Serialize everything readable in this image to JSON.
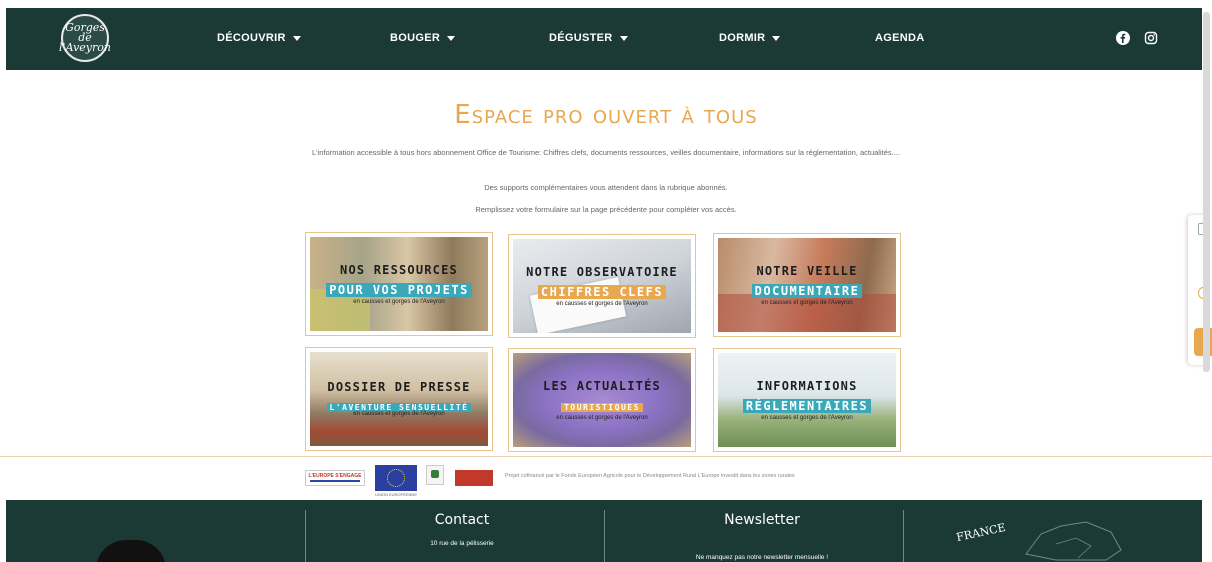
{
  "header": {
    "logo_text": "Gorges de l'Aveyron",
    "nav": [
      {
        "label": "DÉCOUVRIR",
        "dropdown": true
      },
      {
        "label": "BOUGER",
        "dropdown": true
      },
      {
        "label": "DÉGUSTER",
        "dropdown": true
      },
      {
        "label": "DORMIR",
        "dropdown": true
      },
      {
        "label": "AGENDA",
        "dropdown": false
      }
    ],
    "social": [
      "facebook-icon",
      "instagram-icon"
    ]
  },
  "intro": {
    "title": "Espace pro ouvert à tous",
    "p1": "L'information accessible à tous hors abonnement Office de Tourisme: Chiffres clefs, documents ressources, veilles documentaire, informations sur la réglementation, actualités....",
    "p2": "Des supports complémentaires vous attendent dans la rubrique abonnés.",
    "p3": "Remplissez votre formulaire sur la page précédente pour compléter vos accès."
  },
  "tiles": [
    {
      "line1": "NOS RESSOURCES",
      "line2": "POUR VOS PROJETS",
      "line3": "en causses et gorges de l'Aveyron"
    },
    {
      "line1": "NOTRE OBSERVATOIRE",
      "line2": "CHIFFRES CLEFS",
      "line3": "en causses et gorges de l'Aveyron"
    },
    {
      "line1": "NOTRE VEILLE",
      "line2": "DOCUMENTAIRE",
      "line3": "en causses et gorges de l'Aveyron"
    },
    {
      "line1": "DOSSIER DE PRESSE",
      "line2": "L'AVENTURE SENSUELLITÉ",
      "line3": "en causses et gorges de l'Aveyron"
    },
    {
      "line1": "LES ACTUALITÉS",
      "line2": "TOURISTIQUES",
      "line3": "en causses et gorges de l'Aveyron"
    },
    {
      "line1": "INFORMATIONS",
      "line2": "RÉGLEMENTAIRES",
      "line3": "en causses et gorges de l'Aveyron"
    }
  ],
  "partners": {
    "europe_label": "L'EUROPE S'ENGAGE",
    "eu_caption": "UNION EUROPÉENNE",
    "text": "Projet cofinancé par le Fonds Européen Agricole pour le Développement Rural L'Europe investit dans les zones rurales"
  },
  "footer": {
    "contact_title": "Contact",
    "contact_address": "10 rue de la pélisserie",
    "newsletter_title": "Newsletter",
    "newsletter_text": "Ne manquez pas notre newsletter mensuelle !",
    "map_label": "FRANCE"
  },
  "colors": {
    "dark_green": "#1b3a36",
    "orange": "#e8a84f",
    "teal": "#3aa8b8"
  }
}
